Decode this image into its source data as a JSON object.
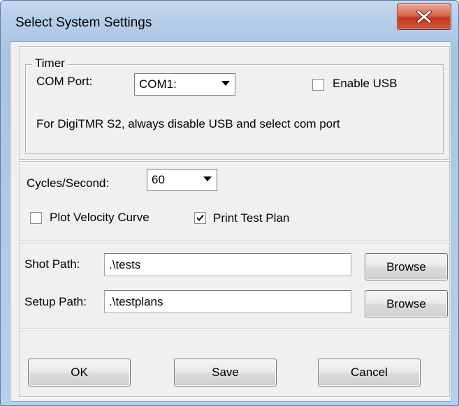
{
  "window": {
    "title": "Select System Settings"
  },
  "timer_group": {
    "legend": "Timer",
    "com_port_label": "COM Port:",
    "com_port_value": "COM1:",
    "enable_usb_label": "Enable USB",
    "enable_usb_checked": false,
    "note": "For DigiTMR S2, always disable USB and select com port"
  },
  "cycles": {
    "label": "Cycles/Second:",
    "value": "60",
    "plot_velocity_label": "Plot Velocity Curve",
    "plot_velocity_checked": false,
    "print_test_plan_label": "Print Test Plan",
    "print_test_plan_checked": true
  },
  "paths": {
    "shot_label": "Shot Path:",
    "shot_value": ".\\tests",
    "setup_label": "Setup Path:",
    "setup_value": ".\\testplans",
    "browse_label": "Browse"
  },
  "buttons": {
    "ok": "OK",
    "save": "Save",
    "cancel": "Cancel"
  }
}
